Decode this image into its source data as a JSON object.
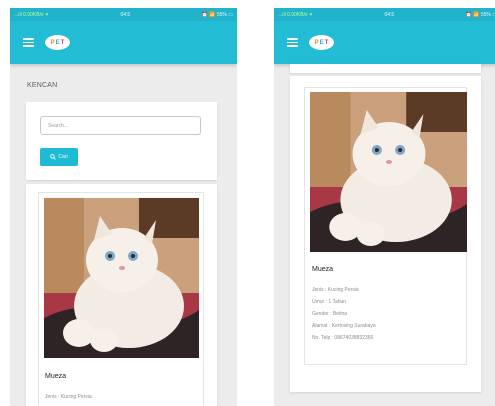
{
  "status_bar": {
    "left": "...ıll 0.00KB/s ✦",
    "center": "04:5",
    "right": "⏰ 📶 55% ▭"
  },
  "app": {
    "logo_letters": [
      "P",
      "E",
      "T"
    ]
  },
  "section": {
    "title": "KENCAN"
  },
  "search": {
    "placeholder": "Search...",
    "button_label": "Cari"
  },
  "cat": {
    "name": "Mueza",
    "details": [
      "Jenis : Kucing Persia",
      "Umur : 1 Tahun",
      "Gender : Betina",
      "Alamat : Kertosing Surabaya",
      "No. Telp : 08674038832366"
    ]
  },
  "colors": {
    "primary": "#22bcd4",
    "button": "#1fbad3",
    "status_bar": "#20b3cc"
  }
}
